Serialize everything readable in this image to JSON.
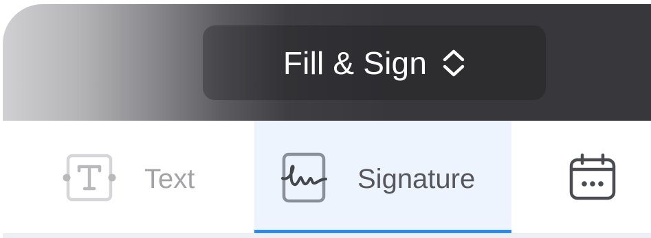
{
  "header": {
    "mode_label": "Fill & Sign",
    "mode_icon": "chevron-up-down-icon"
  },
  "toolbar": {
    "tools": [
      {
        "label": "Text",
        "icon": "text-box-icon",
        "active": false
      },
      {
        "label": "Signature",
        "icon": "signature-icon",
        "active": true
      },
      {
        "label": "",
        "icon": "calendar-date-icon",
        "active": false
      }
    ]
  },
  "colors": {
    "header_dark": "#38383c",
    "active_background": "#edf4fd",
    "active_underline": "#2f8ae9"
  }
}
